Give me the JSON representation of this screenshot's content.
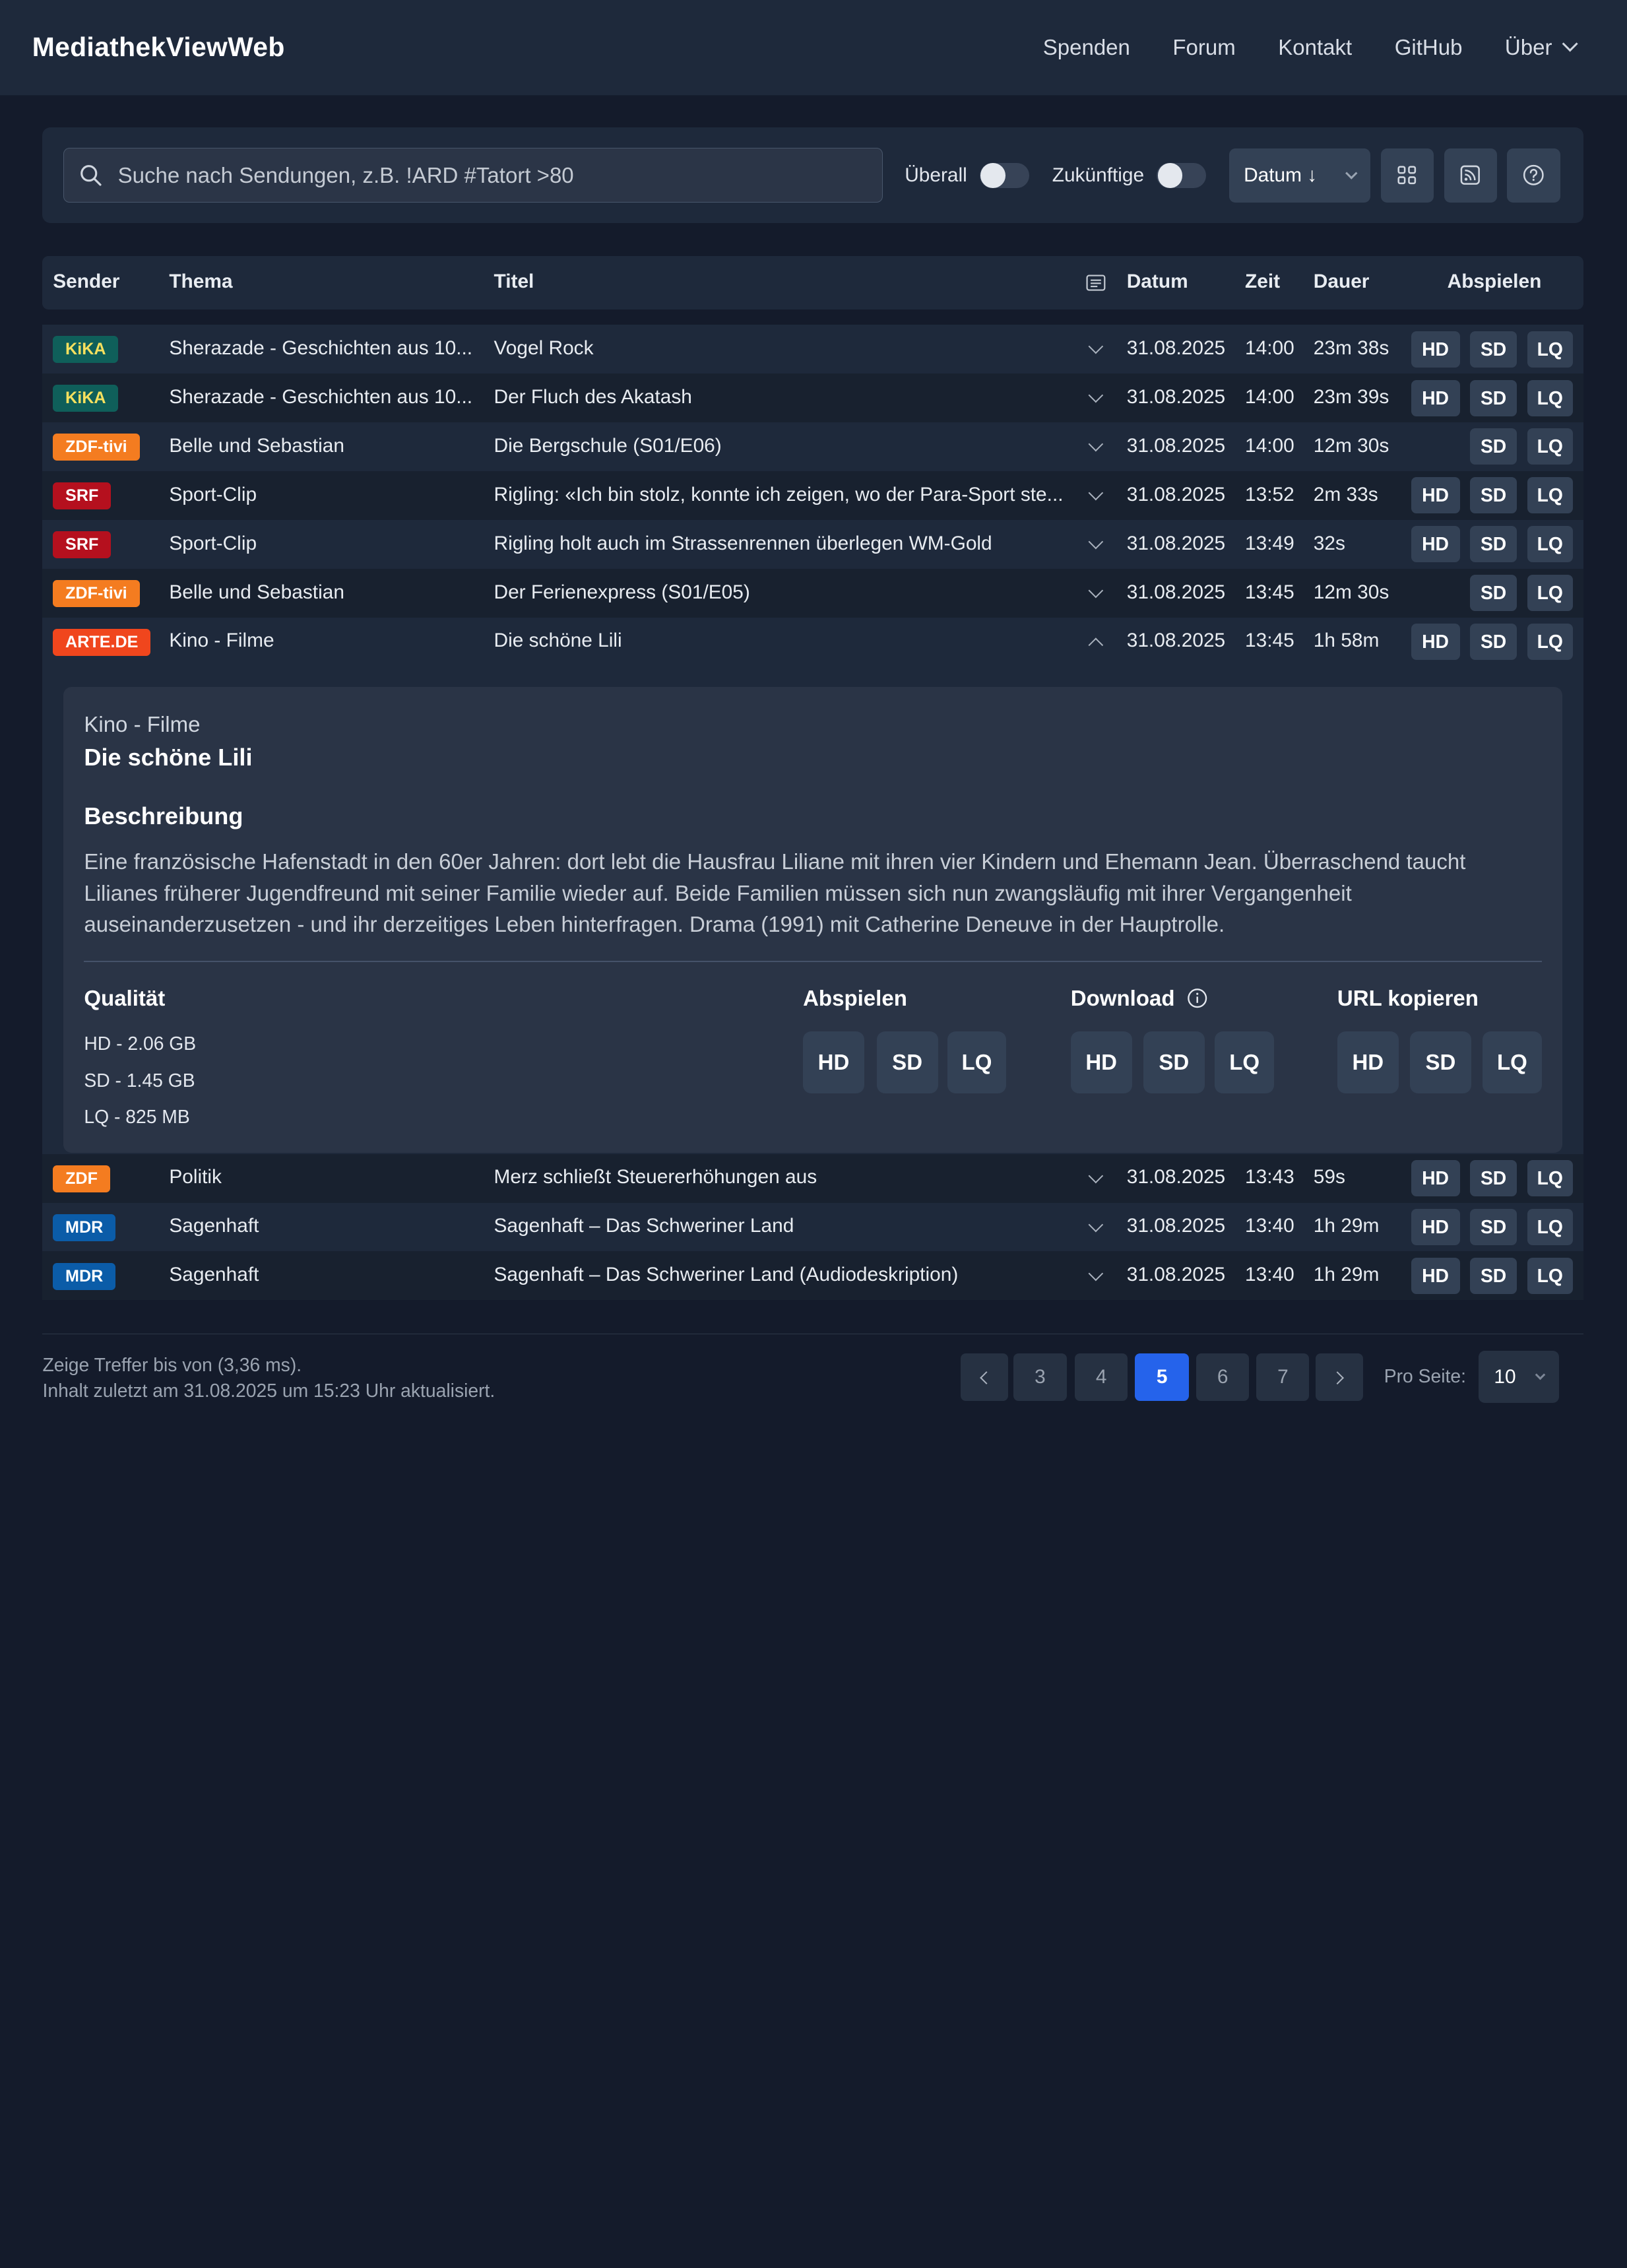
{
  "navbar": {
    "brand": "MediathekViewWeb",
    "links": [
      "Spenden",
      "Forum",
      "Kontakt",
      "GitHub",
      "Über"
    ]
  },
  "search": {
    "placeholder": "Suche nach Sendungen, z.B. !ARD #Tatort >80",
    "toggle_everywhere": "Überall",
    "toggle_future": "Zukünftige",
    "sort_label": "Datum ↓"
  },
  "table": {
    "headers": {
      "sender": "Sender",
      "thema": "Thema",
      "titel": "Titel",
      "datum": "Datum",
      "zeit": "Zeit",
      "dauer": "Dauer",
      "abspielen": "Abspielen"
    },
    "rows": [
      {
        "sender": "KiKA",
        "sender_bg": "#0f5f5a",
        "sender_fg": "#f6e05e",
        "thema": "Sherazade - Geschichten aus 10...",
        "titel": "Vogel Rock",
        "datum": "31.08.2025",
        "zeit": "14:00",
        "dauer": "23m 38s",
        "hd": "HD",
        "sd": "SD",
        "lq": "LQ"
      },
      {
        "sender": "KiKA",
        "sender_bg": "#0f5f5a",
        "sender_fg": "#f6e05e",
        "thema": "Sherazade - Geschichten aus 10...",
        "titel": "Der Fluch des Akatash",
        "datum": "31.08.2025",
        "zeit": "14:00",
        "dauer": "23m 39s",
        "hd": "HD",
        "sd": "SD",
        "lq": "LQ"
      },
      {
        "sender": "ZDF-tivi",
        "sender_bg": "#f47c20",
        "sender_fg": "#ffffff",
        "thema": "Belle und Sebastian",
        "titel": "Die Bergschule (S01/E06)",
        "datum": "31.08.2025",
        "zeit": "14:00",
        "dauer": "12m 30s",
        "hd": "",
        "sd": "SD",
        "lq": "LQ"
      },
      {
        "sender": "SRF",
        "sender_bg": "#b5101e",
        "sender_fg": "#ffffff",
        "thema": "Sport-Clip",
        "titel": "Rigling: «Ich bin stolz, konnte ich zeigen, wo der Para-Sport ste...",
        "datum": "31.08.2025",
        "zeit": "13:52",
        "dauer": "2m 33s",
        "hd": "HD",
        "sd": "SD",
        "lq": "LQ"
      },
      {
        "sender": "SRF",
        "sender_bg": "#b5101e",
        "sender_fg": "#ffffff",
        "thema": "Sport-Clip",
        "titel": "Rigling holt auch im Strassenrennen überlegen WM-Gold",
        "datum": "31.08.2025",
        "zeit": "13:49",
        "dauer": "32s",
        "hd": "HD",
        "sd": "SD",
        "lq": "LQ"
      },
      {
        "sender": "ZDF-tivi",
        "sender_bg": "#f47c20",
        "sender_fg": "#ffffff",
        "thema": "Belle und Sebastian",
        "titel": "Der Ferienexpress (S01/E05)",
        "datum": "31.08.2025",
        "zeit": "13:45",
        "dauer": "12m 30s",
        "hd": "",
        "sd": "SD",
        "lq": "LQ"
      },
      {
        "sender": "ARTE.DE",
        "sender_bg": "#f0461d",
        "sender_fg": "#ffffff",
        "thema": "Kino - Filme",
        "titel": "Die schöne Lili",
        "datum": "31.08.2025",
        "zeit": "13:45",
        "dauer": "1h 58m",
        "hd": "HD",
        "sd": "SD",
        "lq": "LQ"
      }
    ],
    "rows_after": [
      {
        "sender": "ZDF",
        "sender_bg": "#f47c20",
        "sender_fg": "#ffffff",
        "thema": "Politik",
        "titel": "Merz schließt Steuererhöhungen aus",
        "datum": "31.08.2025",
        "zeit": "13:43",
        "dauer": "59s",
        "hd": "HD",
        "sd": "SD",
        "lq": "LQ"
      },
      {
        "sender": "MDR",
        "sender_bg": "#0b5ca8",
        "sender_fg": "#ffffff",
        "thema": "Sagenhaft",
        "titel": "Sagenhaft – Das Schweriner Land",
        "datum": "31.08.2025",
        "zeit": "13:40",
        "dauer": "1h 29m",
        "hd": "HD",
        "sd": "SD",
        "lq": "LQ"
      },
      {
        "sender": "MDR",
        "sender_bg": "#0b5ca8",
        "sender_fg": "#ffffff",
        "thema": "Sagenhaft",
        "titel": "Sagenhaft – Das Schweriner Land (Audiodeskription)",
        "datum": "31.08.2025",
        "zeit": "13:40",
        "dauer": "1h 29m",
        "hd": "HD",
        "sd": "SD",
        "lq": "LQ"
      }
    ]
  },
  "detail": {
    "topic": "Kino - Filme",
    "title": "Die schöne Lili",
    "description_heading": "Beschreibung",
    "description": "Eine französische Hafenstadt in den 60er Jahren: dort lebt die Hausfrau Liliane mit ihren vier Kindern und Ehemann Jean. Überraschend taucht Lilianes früherer Jugendfreund mit seiner Familie wieder auf. Beide Familien müssen sich nun zwangsläufig mit ihrer Vergangenheit auseinanderzusetzen - und ihr derzeitiges Leben hinterfragen. Drama (1991) mit Catherine Deneuve in der Hauptrolle.",
    "quality_heading": "Qualität",
    "sizes": [
      "HD - 2.06 GB",
      "SD  - 1.45 GB",
      "LQ  - 825 MB"
    ],
    "play_heading": "Abspielen",
    "download_heading": "Download",
    "copy_heading": "URL kopieren",
    "buttons": [
      "HD",
      "SD",
      "LQ"
    ]
  },
  "footer": {
    "line1": "Zeige Treffer bis von (3,36 ms).",
    "line2": "Inhalt zuletzt am 31.08.2025 um 15:23 Uhr aktualisiert.",
    "pages": [
      "3",
      "4",
      "5",
      "6",
      "7"
    ],
    "active_page": "5",
    "per_page_label": "Pro Seite:",
    "per_page_value": "10"
  }
}
